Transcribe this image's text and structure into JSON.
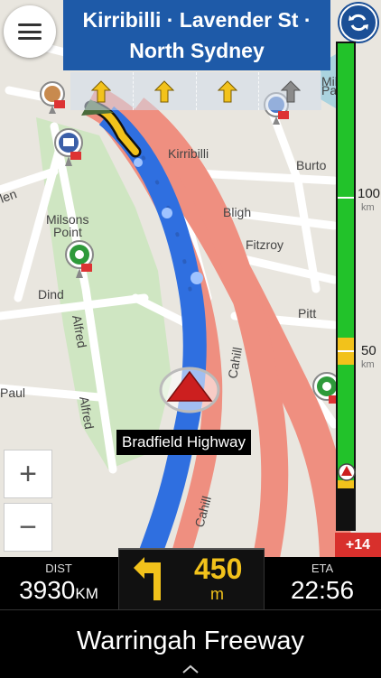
{
  "route_header": {
    "line1": "Kirribilli · Lavender St ·",
    "line2": "North Sydney"
  },
  "map_labels": {
    "kirribilli": "Kirribilli",
    "burton": "Burto",
    "bligh": "Bligh",
    "fitzroy": "Fitzroy",
    "milsons": "Milsons",
    "point": "Point",
    "dind": "Dind",
    "alfred1": "Alfred",
    "alfred2": "Alfred",
    "paul": "Paul",
    "pitt": "Pitt",
    "cahill1": "Cahill",
    "cahill2": "Cahill",
    "glen": "len",
    "milsons_tr": "Mils",
    "pa": "Pa"
  },
  "speed_scale": {
    "mark_100": "100",
    "unit_100": "km",
    "mark_50": "50",
    "unit_50": "km"
  },
  "traffic_delay": "+14",
  "current_road": "Bradfield Highway",
  "zoom": {
    "in": "+",
    "out": "−"
  },
  "distance": {
    "caption": "DIST",
    "value": "3930",
    "unit": "KM"
  },
  "eta": {
    "caption": "ETA",
    "value": "22:56"
  },
  "next_turn": {
    "distance": "450",
    "unit": "m",
    "direction": "left"
  },
  "next_street": "Warringah Freeway",
  "colors": {
    "header_blue": "#1e5aa8",
    "route_blue": "#2f6fe0",
    "highway_red": "#ef8f80",
    "speed_green": "#22c22a",
    "turn_yellow": "#f2c21b",
    "badge_red": "#d8302c"
  }
}
